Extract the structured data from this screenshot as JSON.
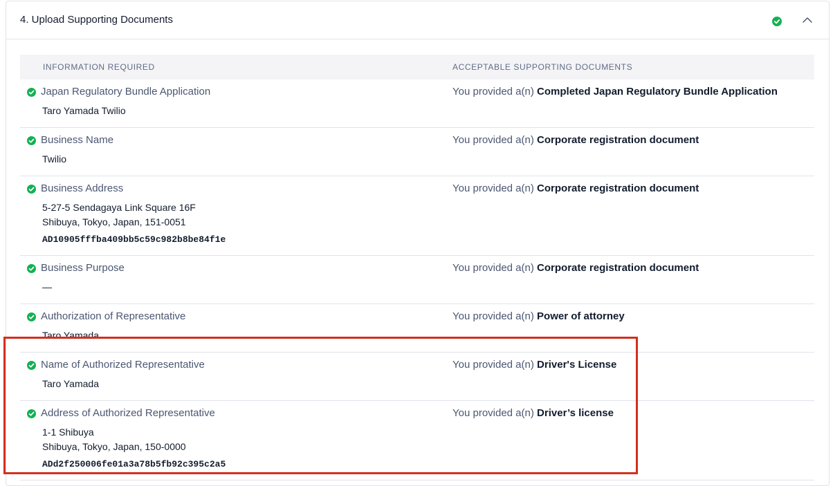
{
  "section": {
    "title": "4. Upload Supporting Documents",
    "status_icon": "check-circle-icon",
    "toggle_icon": "chevron-up-icon"
  },
  "colors": {
    "success": "#14b053",
    "highlight": "#d32f1e",
    "header_bg": "#f4f4f6"
  },
  "table": {
    "headers": {
      "left": "INFORMATION REQUIRED",
      "right": "ACCEPTABLE SUPPORTING DOCUMENTS"
    },
    "doc_prefix": "You provided a(n)",
    "rows": [
      {
        "label": "Japan Regulatory Bundle Application",
        "values": [
          "Taro Yamada Twilio"
        ],
        "sid": "",
        "document": "Completed Japan Regulatory Bundle Application"
      },
      {
        "label": "Business Name",
        "values": [
          "Twilio"
        ],
        "sid": "",
        "document": "Corporate registration document"
      },
      {
        "label": "Business Address",
        "values": [
          "5-27-5 Sendagaya Link Square 16F",
          "Shibuya, Tokyo, Japan, 151-0051"
        ],
        "sid": "AD10905fffba409bb5c59c982b8be84f1e",
        "document": "Corporate registration document"
      },
      {
        "label": "Business Purpose",
        "values": [
          "—"
        ],
        "sid": "",
        "document": "Corporate registration document"
      },
      {
        "label": "Authorization of Representative",
        "values": [
          "Taro Yamada"
        ],
        "sid": "",
        "document": "Power of attorney"
      },
      {
        "label": "Name of Authorized Representative",
        "values": [
          "Taro Yamada"
        ],
        "sid": "",
        "document": "Driver's License"
      },
      {
        "label": "Address of Authorized Representative",
        "values": [
          "1-1 Shibuya",
          "Shibuya, Tokyo, Japan, 150-0000"
        ],
        "sid": "ADd2f250006fe01a3a78b5fb92c395c2a5",
        "document": "Driver’s license"
      }
    ]
  }
}
